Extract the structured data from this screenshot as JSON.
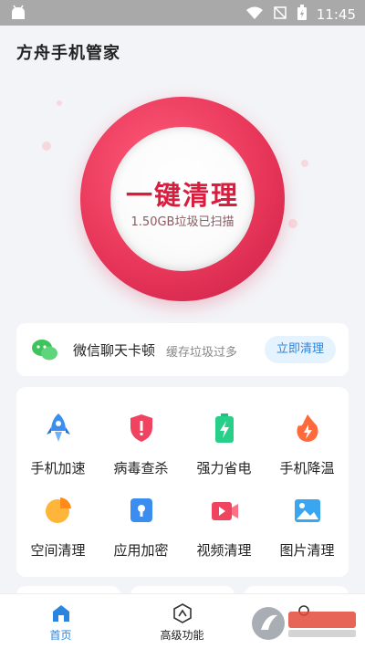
{
  "status_bar": {
    "time": "11:45"
  },
  "app": {
    "title": "方舟手机管家"
  },
  "clean": {
    "title": "一键清理",
    "subtitle": "1.50GB垃圾已扫描"
  },
  "wechat": {
    "title": "微信聊天卡顿",
    "desc": "缓存垃圾过多",
    "button": "立即清理"
  },
  "tools": [
    {
      "label": "手机加速",
      "icon": "rocket-icon"
    },
    {
      "label": "病毒查杀",
      "icon": "shield-icon"
    },
    {
      "label": "强力省电",
      "icon": "battery-icon"
    },
    {
      "label": "手机降温",
      "icon": "flame-icon"
    },
    {
      "label": "空间清理",
      "icon": "pie-chart-icon"
    },
    {
      "label": "应用加密",
      "icon": "lock-icon"
    },
    {
      "label": "视频清理",
      "icon": "video-icon"
    },
    {
      "label": "图片清理",
      "icon": "image-icon"
    }
  ],
  "tabs": [
    {
      "label": "首页",
      "icon": "home-icon",
      "active": true
    },
    {
      "label": "高级功能",
      "icon": "hexagon-icon",
      "active": false
    }
  ],
  "colors": {
    "accent": "#e8375a",
    "primary": "#2a85e0"
  }
}
